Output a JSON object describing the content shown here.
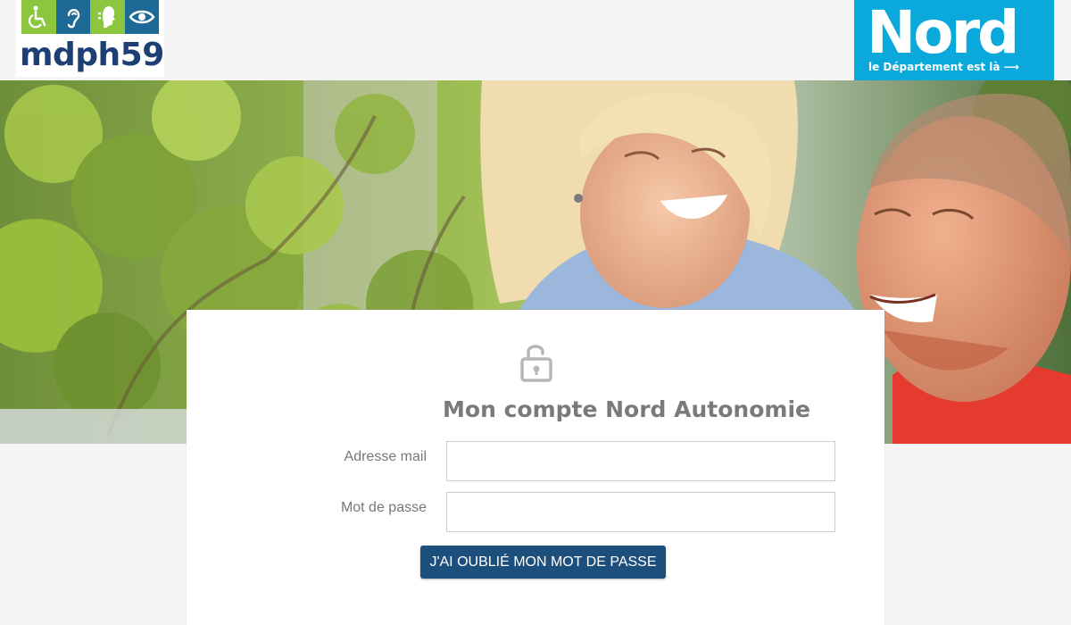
{
  "header": {
    "mdph_logo": {
      "text": "mdph59",
      "icons": [
        "wheelchair-icon",
        "ear-icon",
        "face-profile-icon",
        "eye-icon"
      ],
      "colors": {
        "green": "#8cc63f",
        "blue": "#1d6a96",
        "text": "#1d3f73"
      }
    },
    "nord_logo": {
      "word": "Nord",
      "tagline": "le Département est là ⟶",
      "color": "#0aa8db"
    }
  },
  "banner": {
    "image": "photo-smiling-woman-and-man-with-foliage"
  },
  "login": {
    "icon": "lock-open-icon",
    "title": "Mon compte Nord Autonomie",
    "email_label": "Adresse mail",
    "email_value": "",
    "password_label": "Mot de passe",
    "password_value": "",
    "forgot_button": "J'AI OUBLIÉ MON MOT DE PASSE",
    "button_color": "#1d4f7c"
  }
}
